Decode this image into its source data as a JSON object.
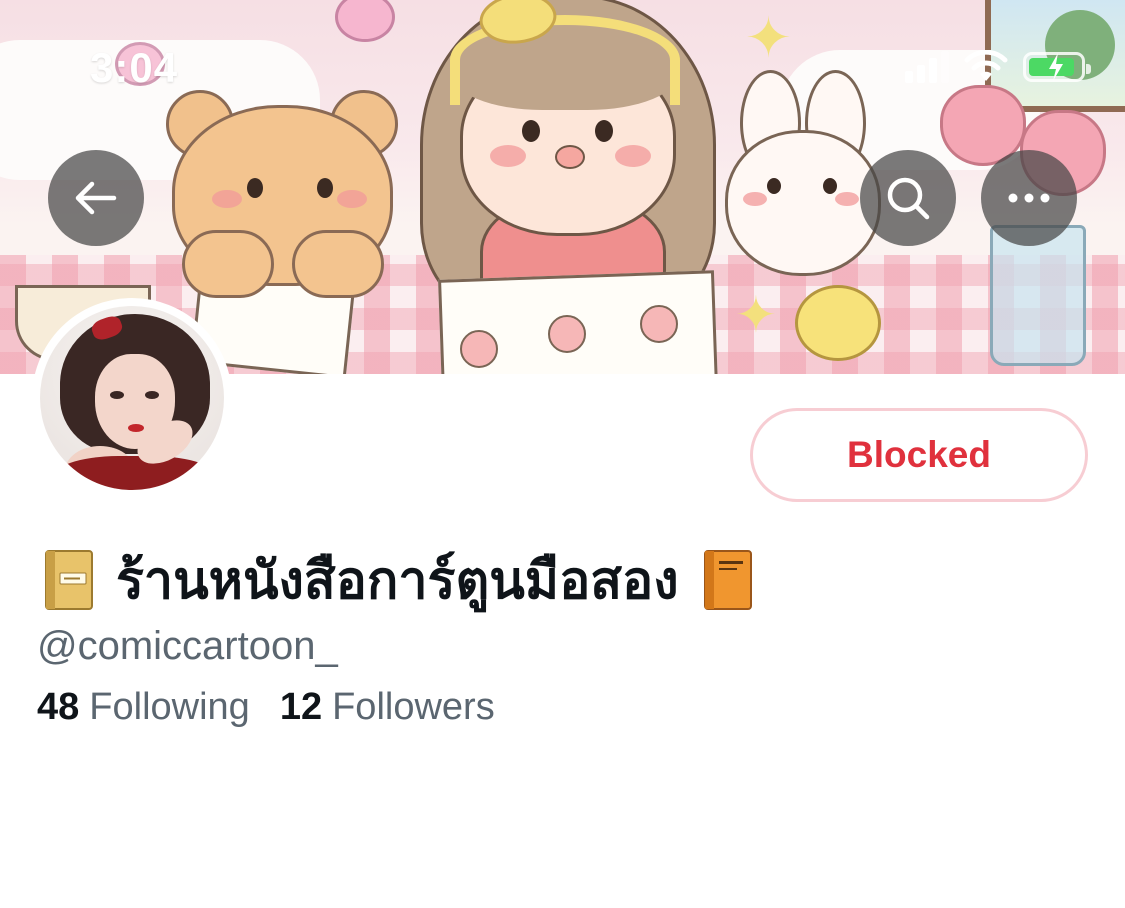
{
  "status_bar": {
    "time": "3:04",
    "signal_bars": 3,
    "battery_level": 0.9,
    "charging": true,
    "battery_color": "#4cd964"
  },
  "header": {
    "back_icon": "arrow-left-icon",
    "search_icon": "search-icon",
    "more_icon": "ellipsis-icon"
  },
  "profile": {
    "display_name": "ร้านหนังสือการ์ตูนมือสอง",
    "name_prefix_icon": "notebook-icon",
    "name_suffix_icon": "orange-book-icon",
    "handle": "@comiccartoon_",
    "blocked_label": "Blocked",
    "blocked_color": "#e0313d",
    "following_count": "48",
    "following_label": "Following",
    "followers_count": "12",
    "followers_label": "Followers"
  }
}
